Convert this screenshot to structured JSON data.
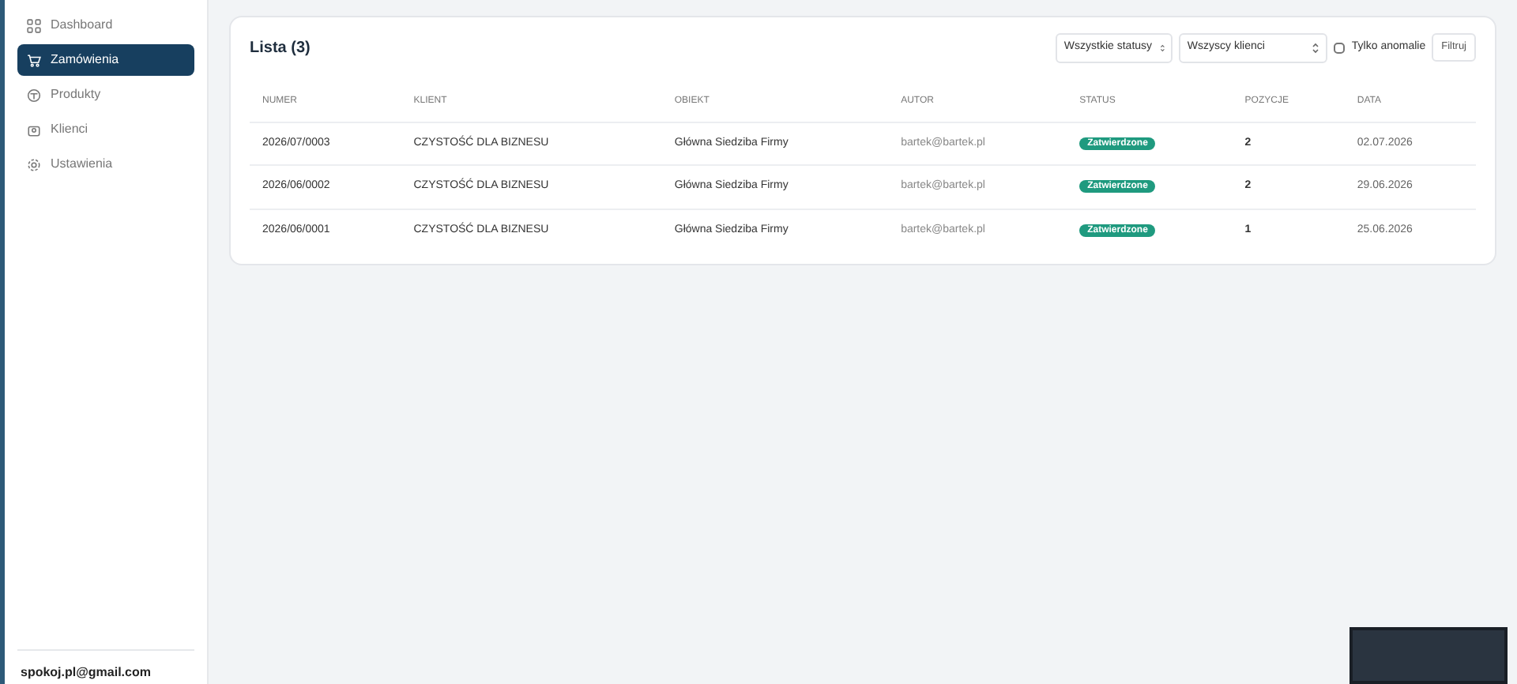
{
  "sidebar": {
    "items": [
      {
        "label": "Dashboard",
        "kind": "grid",
        "selected": false
      },
      {
        "label": "Zamówienia",
        "kind": "cart",
        "selected": true
      },
      {
        "label": "Produkty",
        "kind": "box",
        "selected": false
      },
      {
        "label": "Klienci",
        "kind": "people",
        "selected": false
      },
      {
        "label": "Ustawienia",
        "kind": "gear",
        "selected": false
      }
    ],
    "user_email": "spokoj.pl@gmail.com"
  },
  "card": {
    "title": "Lista (3)",
    "filters": {
      "status_select": "Wszystkie statusy",
      "client_select": "Wszyscy klienci",
      "anomalies_checkbox": {
        "label": "Tylko anomalie",
        "checked": false
      },
      "filter_button": "Filtruj"
    },
    "table": {
      "columns": [
        "NUMER",
        "KLIENT",
        "OBIEKT",
        "AUTOR",
        "STATUS",
        "POZYCJE",
        "DATA"
      ],
      "rows": [
        {
          "numer": "2026/07/0003",
          "klient": "CZYSTOŚĆ DLA BIZNESU",
          "obiekt": "Główna Siedziba Firmy",
          "autor": "bartek@bartek.pl",
          "status": "Zatwierdzone",
          "pozycje": "2",
          "data": "02.07.2026"
        },
        {
          "numer": "2026/06/0002",
          "klient": "CZYSTOŚĆ DLA BIZNESU",
          "obiekt": "Główna Siedziba Firmy",
          "autor": "bartek@bartek.pl",
          "status": "Zatwierdzone",
          "pozycje": "2",
          "data": "29.06.2026"
        },
        {
          "numer": "2026/06/0001",
          "klient": "CZYSTOŚĆ DLA BIZNESU",
          "obiekt": "Główna Siedziba Firmy",
          "autor": "bartek@bartek.pl",
          "status": "Zatwierdzone",
          "pozycje": "1",
          "data": "25.06.2026"
        }
      ]
    }
  }
}
